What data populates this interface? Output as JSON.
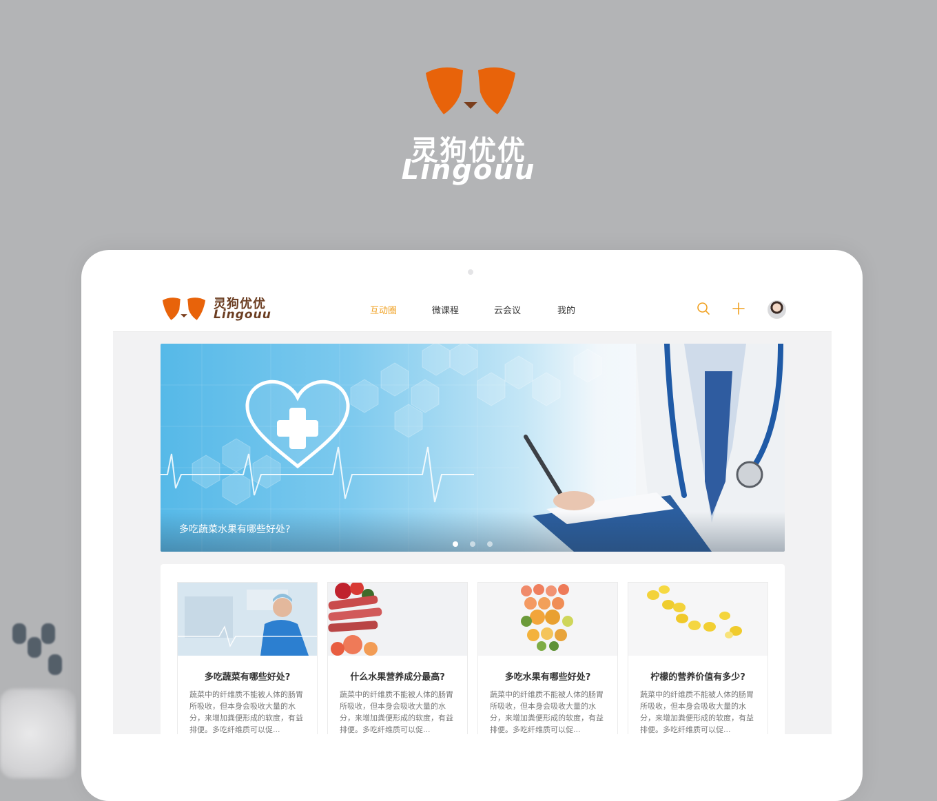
{
  "hero": {
    "brand_cn": "灵狗优优",
    "brand_en": "Lingouu"
  },
  "nav": {
    "brand_cn": "灵狗优优",
    "brand_en": "Lingouu",
    "tabs": [
      {
        "label": "互动圈",
        "active": true
      },
      {
        "label": "微课程",
        "active": false
      },
      {
        "label": "云会议",
        "active": false
      },
      {
        "label": "我的",
        "active": false
      }
    ],
    "icons": [
      "search-icon",
      "plus-icon",
      "avatar"
    ]
  },
  "banner": {
    "caption": "多吃蔬菜水果有哪些好处?",
    "slide_count": 3,
    "active_slide": 1
  },
  "cards": [
    {
      "title": "多吃蔬菜有哪些好处?",
      "desc": "蔬菜中的纤维质不能被人体的肠胃所吸收，但本身会吸收大量的水分，来增加粪便形成的软度，有益排便。多吃纤维质可以促...",
      "image": "doctor"
    },
    {
      "title": "什么水果营养成分最高?",
      "desc": "蔬菜中的纤维质不能被人体的肠胃所吸收，但本身会吸收大量的水分，来增加粪便形成的软度，有益排便。多吃纤维质可以促...",
      "image": "fruits-rhubarb"
    },
    {
      "title": "多吃水果有哪些好处?",
      "desc": "蔬菜中的纤维质不能被人体的肠胃所吸收，但本身会吸收大量的水分，来增加粪便形成的软度，有益排便。多吃纤维质可以促...",
      "image": "citrus-arrangement"
    },
    {
      "title": "柠檬的营养价值有多少?",
      "desc": "蔬菜中的纤维质不能被人体的肠胃所吸收，但本身会吸收大量的水分，来增加粪便形成的软度，有益排便。多吃纤维质可以促...",
      "image": "lemons"
    }
  ],
  "colors": {
    "brand_orange": "#e8630a",
    "accent": "#f0a020",
    "brand_brown": "#6b3d21",
    "background": "#b3b4b6"
  }
}
